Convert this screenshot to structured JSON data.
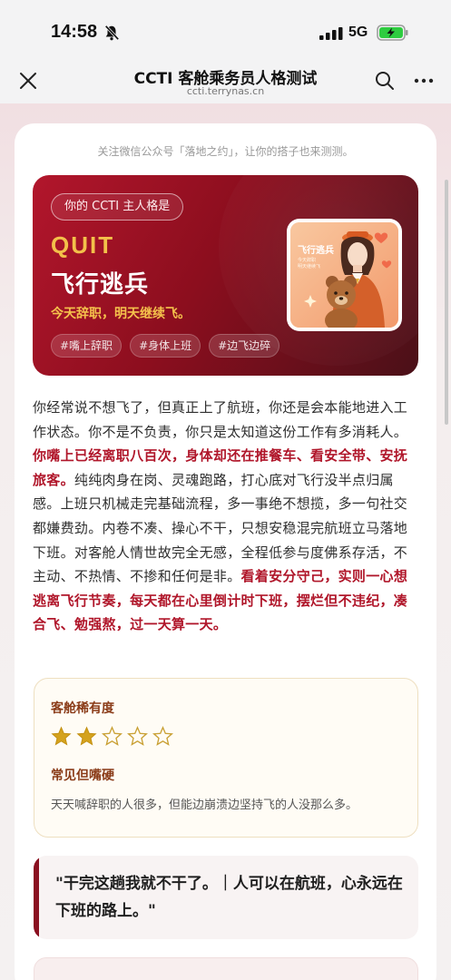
{
  "status_bar": {
    "time": "14:58",
    "network": "5G",
    "icons": [
      "bell-slash-icon",
      "signal-icon",
      "battery-charging-icon"
    ],
    "battery_color": "#2ecc40"
  },
  "nav": {
    "title": "CCTI 客舱乘务员人格测试",
    "url": "ccti.terrynas.cn",
    "icons": [
      "close-icon",
      "search-icon",
      "more-icon"
    ]
  },
  "result": {
    "follow_notice": "关注微信公众号「落地之约」，让你的搭子也来测测。",
    "chip_label": "你的 CCTI 主人格是",
    "code": "QUIT",
    "name": "飞行逃兵",
    "slogan": "今天辞职，明天继续飞。",
    "tags": [
      "#嘴上辞职",
      "#身体上班",
      "#边飞边碎"
    ],
    "portrait": {
      "title": "飞行逃兵",
      "sub1": "今天辞职",
      "sub2": "明天继续飞"
    },
    "colors": {
      "accent": "#b0162a",
      "gold": "#f3c14a"
    }
  },
  "description": {
    "segments": [
      {
        "text": "你经常说不想飞了，但真正上了航班，你还是会本能地进入工作状态。你不是不负责，你只是太知道这份工作有多消耗人。",
        "emphasis": false
      },
      {
        "text": "你嘴上已经离职八百次，身体却还在推餐车、看安全带、安抚旅客。",
        "emphasis": true
      },
      {
        "text": "纯纯肉身在岗、灵魂跑路，打心底对飞行没半点归属感。上班只机械走完基础流程，多一事绝不想揽，多一句社交都嫌费劲。内卷不凑、操心不干，只想安稳混完航班立马落地下班。对客舱人情世故完全无感，全程低参与度佛系存活，不主动、不热情、不掺和任何是非。",
        "emphasis": false
      },
      {
        "text": "看着安分守己，实则一心想逃离飞行节奏，每天都在心里倒计时下班，摆烂但不违纪，凑合飞、勉强熬，过一天算一天。",
        "emphasis": true
      }
    ]
  },
  "rarity": {
    "title": "客舱稀有度",
    "stars_filled": 2,
    "stars_total": 5,
    "level": "常见但嘴硬",
    "desc": "天天喊辞职的人很多，但能边崩溃边坚持飞的人没那么多。"
  },
  "quote": {
    "text": "\"干完这趟我就不干了。｜人可以在航班，心永远在下班的路上。\""
  }
}
